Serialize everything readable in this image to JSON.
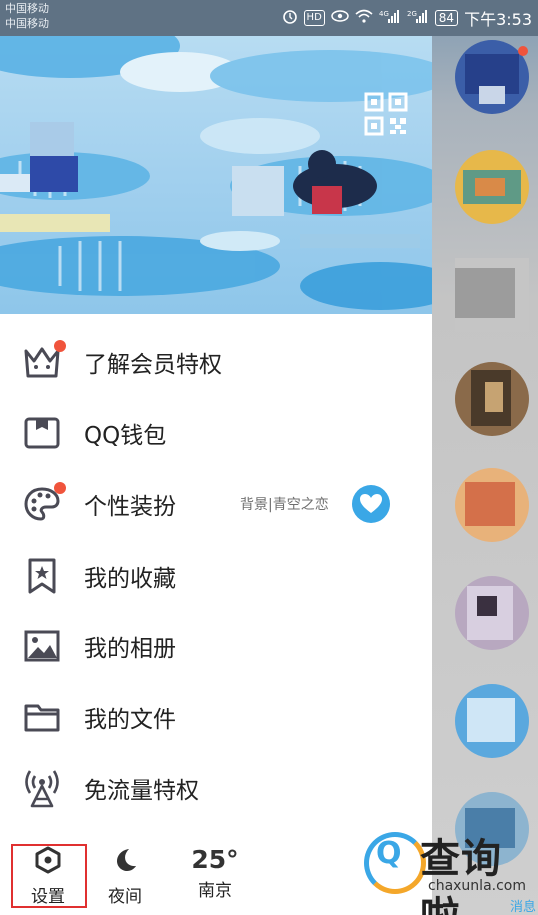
{
  "status_bar": {
    "carrier_1": "中国移动",
    "carrier_2": "中国移动",
    "hd": "HD",
    "net_1": "4G",
    "net_2": "2G",
    "battery": "84",
    "time": "下午3:53"
  },
  "header": {
    "qr_icon": "qr-code-icon"
  },
  "menu": {
    "items": [
      {
        "label": "了解会员特权",
        "icon": "crown-icon",
        "dot": true
      },
      {
        "label": "QQ钱包",
        "icon": "wallet-icon",
        "dot": false
      },
      {
        "label": "个性装扮",
        "icon": "palette-icon",
        "dot": true,
        "tag": "背景|青空之恋"
      },
      {
        "label": "我的收藏",
        "icon": "bookmark-star-icon",
        "dot": false
      },
      {
        "label": "我的相册",
        "icon": "photo-icon",
        "dot": false
      },
      {
        "label": "我的文件",
        "icon": "folder-icon",
        "dot": false
      },
      {
        "label": "免流量特权",
        "icon": "signal-tower-icon",
        "dot": false
      }
    ]
  },
  "bottom": {
    "settings": "设置",
    "night": "夜间",
    "temp": "25°",
    "city": "南京"
  },
  "right_column": {
    "message_label": "消息"
  },
  "watermark": {
    "title": "查询啦",
    "domain": "chaxunla.com",
    "logo_letter": "Q"
  },
  "colors": {
    "accent_blue": "#3aa7e6",
    "badge_red": "#f0543c",
    "highlight_red": "#e03030",
    "status_bar": "#5f7284",
    "icon_gray": "#4a4a55"
  }
}
